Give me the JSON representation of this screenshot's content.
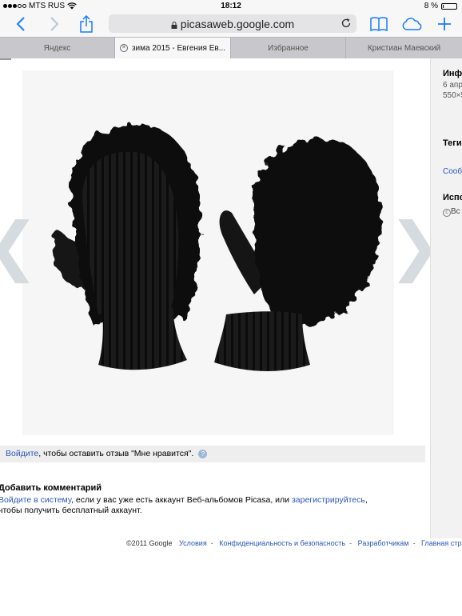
{
  "status": {
    "carrier": "MTS RUS",
    "time": "18:12",
    "battery_text": "8 %",
    "battery_level": 0.08
  },
  "browser": {
    "url": "picasaweb.google.com",
    "tabs": [
      {
        "label": "Яндекс",
        "active": false
      },
      {
        "label": "зима 2015 - Евгения Ев...",
        "active": true
      },
      {
        "label": "Избранное",
        "active": false
      },
      {
        "label": "Кристиан Маевский",
        "active": false
      }
    ]
  },
  "sidebar": {
    "info_title": "Инфо",
    "date": "6 апр",
    "dimensions": "550×5",
    "tags_title": "Теги",
    "report_link": "Сооб",
    "usage_title": "Испо",
    "rights": "Вс"
  },
  "like": {
    "login_link": "Войдите",
    "text": ", чтобы оставить отзыв \"Мне нравится\".",
    "help": "?"
  },
  "comments": {
    "title": "Добавить комментарий",
    "line1_link": "Войдите в систему",
    "line1_text": ", если у вас уже есть аккаунт Веб-альбомов Picasa, или ",
    "line1_link2": "зарегистрируйтесь",
    "line1_end": ",",
    "line2": "чтобы получить бесплатный аккаунт."
  },
  "footer": {
    "copyright": "©2011 Google",
    "links": [
      "Условия",
      "Конфиденциальность и безопасность",
      "Разработчикам",
      "Главная стра"
    ]
  },
  "colors": {
    "link": "#2a57b5",
    "toolbar_icons": "#1a7cf5"
  },
  "icons": {
    "back": "chevron-left-icon",
    "forward": "chevron-right-icon",
    "share": "share-icon",
    "refresh": "refresh-icon",
    "bookmarks": "book-icon",
    "cloud": "cloud-icon",
    "new_tab": "plus-icon"
  }
}
